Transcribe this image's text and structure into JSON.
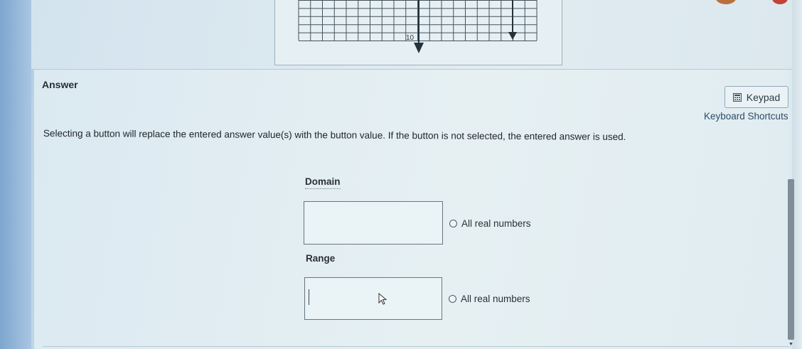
{
  "graph": {
    "tick_label": "10"
  },
  "answer": {
    "heading": "Answer",
    "keypad_label": "Keypad",
    "keyboard_shortcuts_label": "Keyboard Shortcuts",
    "instruction": "Selecting a button will replace the entered answer value(s) with the button value. If the button is not selected, the entered answer is used."
  },
  "domain": {
    "label": "Domain",
    "value": "",
    "option_label": "All real numbers"
  },
  "range": {
    "label": "Range",
    "value": "",
    "option_label": "All real numbers"
  },
  "icons": {
    "keypad": "calculator-icon",
    "cursor": "mouse-pointer-icon",
    "arrow_down": "arrow-down-icon"
  }
}
